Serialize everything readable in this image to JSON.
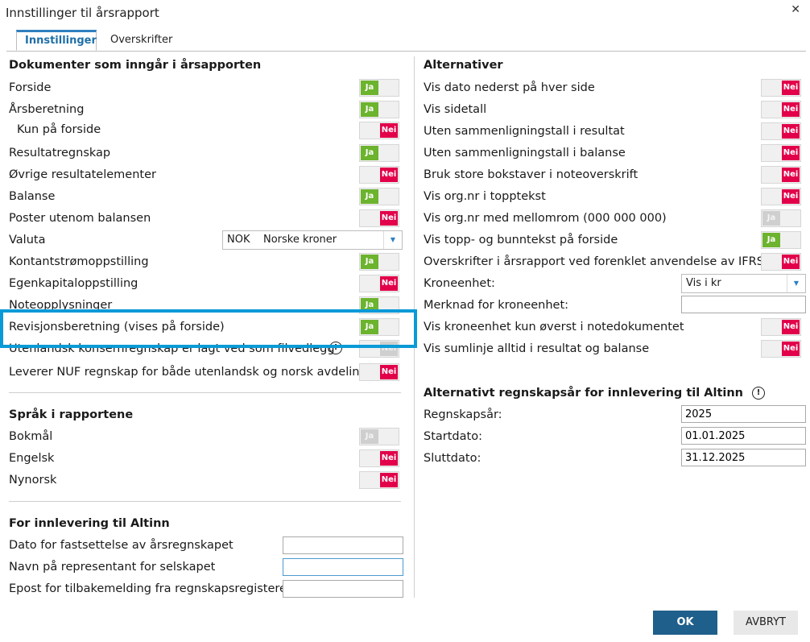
{
  "window": {
    "title": "Innstillinger til årsrapport",
    "close": "✕"
  },
  "tabs": [
    {
      "label": "Innstillinger"
    },
    {
      "label": "Overskrifter"
    }
  ],
  "left": {
    "documents": {
      "heading": "Dokumenter som inngår i årsapporten",
      "items": [
        {
          "label": "Forside",
          "state": "Ja"
        },
        {
          "label": "Årsberetning",
          "state": "Ja"
        },
        {
          "label": "Kun på forside",
          "state": "Nei"
        },
        {
          "label": "Resultatregnskap",
          "state": "Ja"
        },
        {
          "label": "Øvrige resultatelementer",
          "state": "Nei"
        },
        {
          "label": "Balanse",
          "state": "Ja"
        },
        {
          "label": "Poster utenom balansen",
          "state": "Nei"
        },
        {
          "label": "Valuta",
          "code": "NOK",
          "name": "Norske kroner"
        },
        {
          "label": "Kontantstrømoppstilling",
          "state": "Ja"
        },
        {
          "label": "Egenkapitaloppstilling",
          "state": "Nei"
        },
        {
          "label": "Noteopplysninger",
          "state": "Ja"
        },
        {
          "label": "Revisjonsberetning (vises på forside)",
          "state": "Ja"
        },
        {
          "label": "Utenlandsk konsernregnskap er lagt ved som filvedlegg",
          "state": "Nei"
        },
        {
          "label": "Leverer NUF regnskap for både utenlandsk og norsk avdeling",
          "state": "Nei"
        }
      ]
    },
    "languages": {
      "heading": "Språk i rapportene",
      "items": [
        {
          "label": "Bokmål",
          "state": "Ja"
        },
        {
          "label": "Engelsk",
          "state": "Nei"
        },
        {
          "label": "Nynorsk",
          "state": "Nei"
        }
      ]
    },
    "altinn": {
      "heading": "For innlevering til Altinn",
      "fields": [
        {
          "label": "Dato for fastsettelse av årsregnskapet",
          "value": ""
        },
        {
          "label": "Navn på representant for selskapet",
          "value": ""
        },
        {
          "label": "Epost for tilbakemelding fra regnskapsregisteret",
          "value": ""
        }
      ]
    }
  },
  "right": {
    "alternatives": {
      "heading": "Alternativer",
      "items": [
        {
          "label": "Vis dato nederst på hver side",
          "state": "Nei"
        },
        {
          "label": "Vis sidetall",
          "state": "Nei"
        },
        {
          "label": "Uten sammenligningstall i resultat",
          "state": "Nei"
        },
        {
          "label": "Uten sammenligningstall i balanse",
          "state": "Nei"
        },
        {
          "label": "Bruk store bokstaver i noteoverskrift",
          "state": "Nei"
        },
        {
          "label": "Vis org.nr i topptekst",
          "state": "Nei"
        },
        {
          "label": "Vis org.nr med mellomrom (000 000 000)",
          "state": "Ja"
        },
        {
          "label": "Vis topp- og bunntekst på forside",
          "state": "Ja"
        },
        {
          "label": "Overskrifter i årsrapport ved forenklet anvendelse av IFRS",
          "state": "Nei"
        },
        {
          "label": "Kroneenhet:",
          "value": "Vis i kr"
        },
        {
          "label": "Merknad for kroneenhet:",
          "value": ""
        },
        {
          "label": "Vis kroneenhet kun øverst i notedokumentet",
          "state": "Nei"
        },
        {
          "label": "Vis sumlinje alltid i resultat og balanse",
          "state": "Nei"
        }
      ]
    },
    "altyear": {
      "heading": "Alternativt regnskapsår for innlevering til Altinn",
      "info": "!",
      "fields": [
        {
          "label": "Regnskapsår:",
          "value": "2025"
        },
        {
          "label": "Startdato:",
          "value": "01.01.2025"
        },
        {
          "label": "Sluttdato:",
          "value": "31.12.2025"
        }
      ]
    }
  },
  "buttons": {
    "ok": "OK",
    "cancel": "AVBRYT"
  },
  "icons": {
    "info": "!",
    "dropdown": "▼"
  },
  "colors": {
    "ja": "#6cb32e",
    "nei": "#e2004a",
    "accent": "#2e7fbf",
    "highlight": "#0a9ad8"
  }
}
